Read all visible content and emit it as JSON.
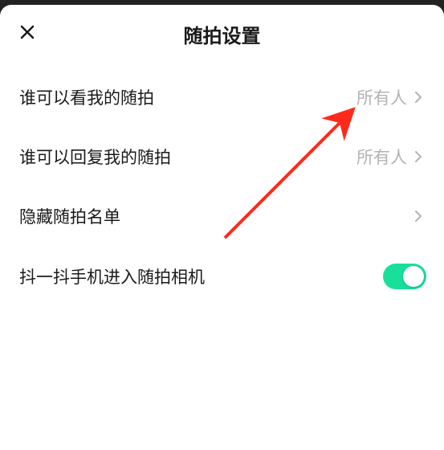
{
  "header": {
    "title": "随拍设置"
  },
  "rows": [
    {
      "label": "谁可以看我的随拍",
      "value": "所有人"
    },
    {
      "label": "谁可以回复我的随拍",
      "value": "所有人"
    },
    {
      "label": "隐藏随拍名单",
      "value": ""
    },
    {
      "label": "抖一抖手机进入随拍相机",
      "toggle": true
    }
  ],
  "colors": {
    "accent": "#18e09a",
    "annotation": "#ff2a1a"
  }
}
